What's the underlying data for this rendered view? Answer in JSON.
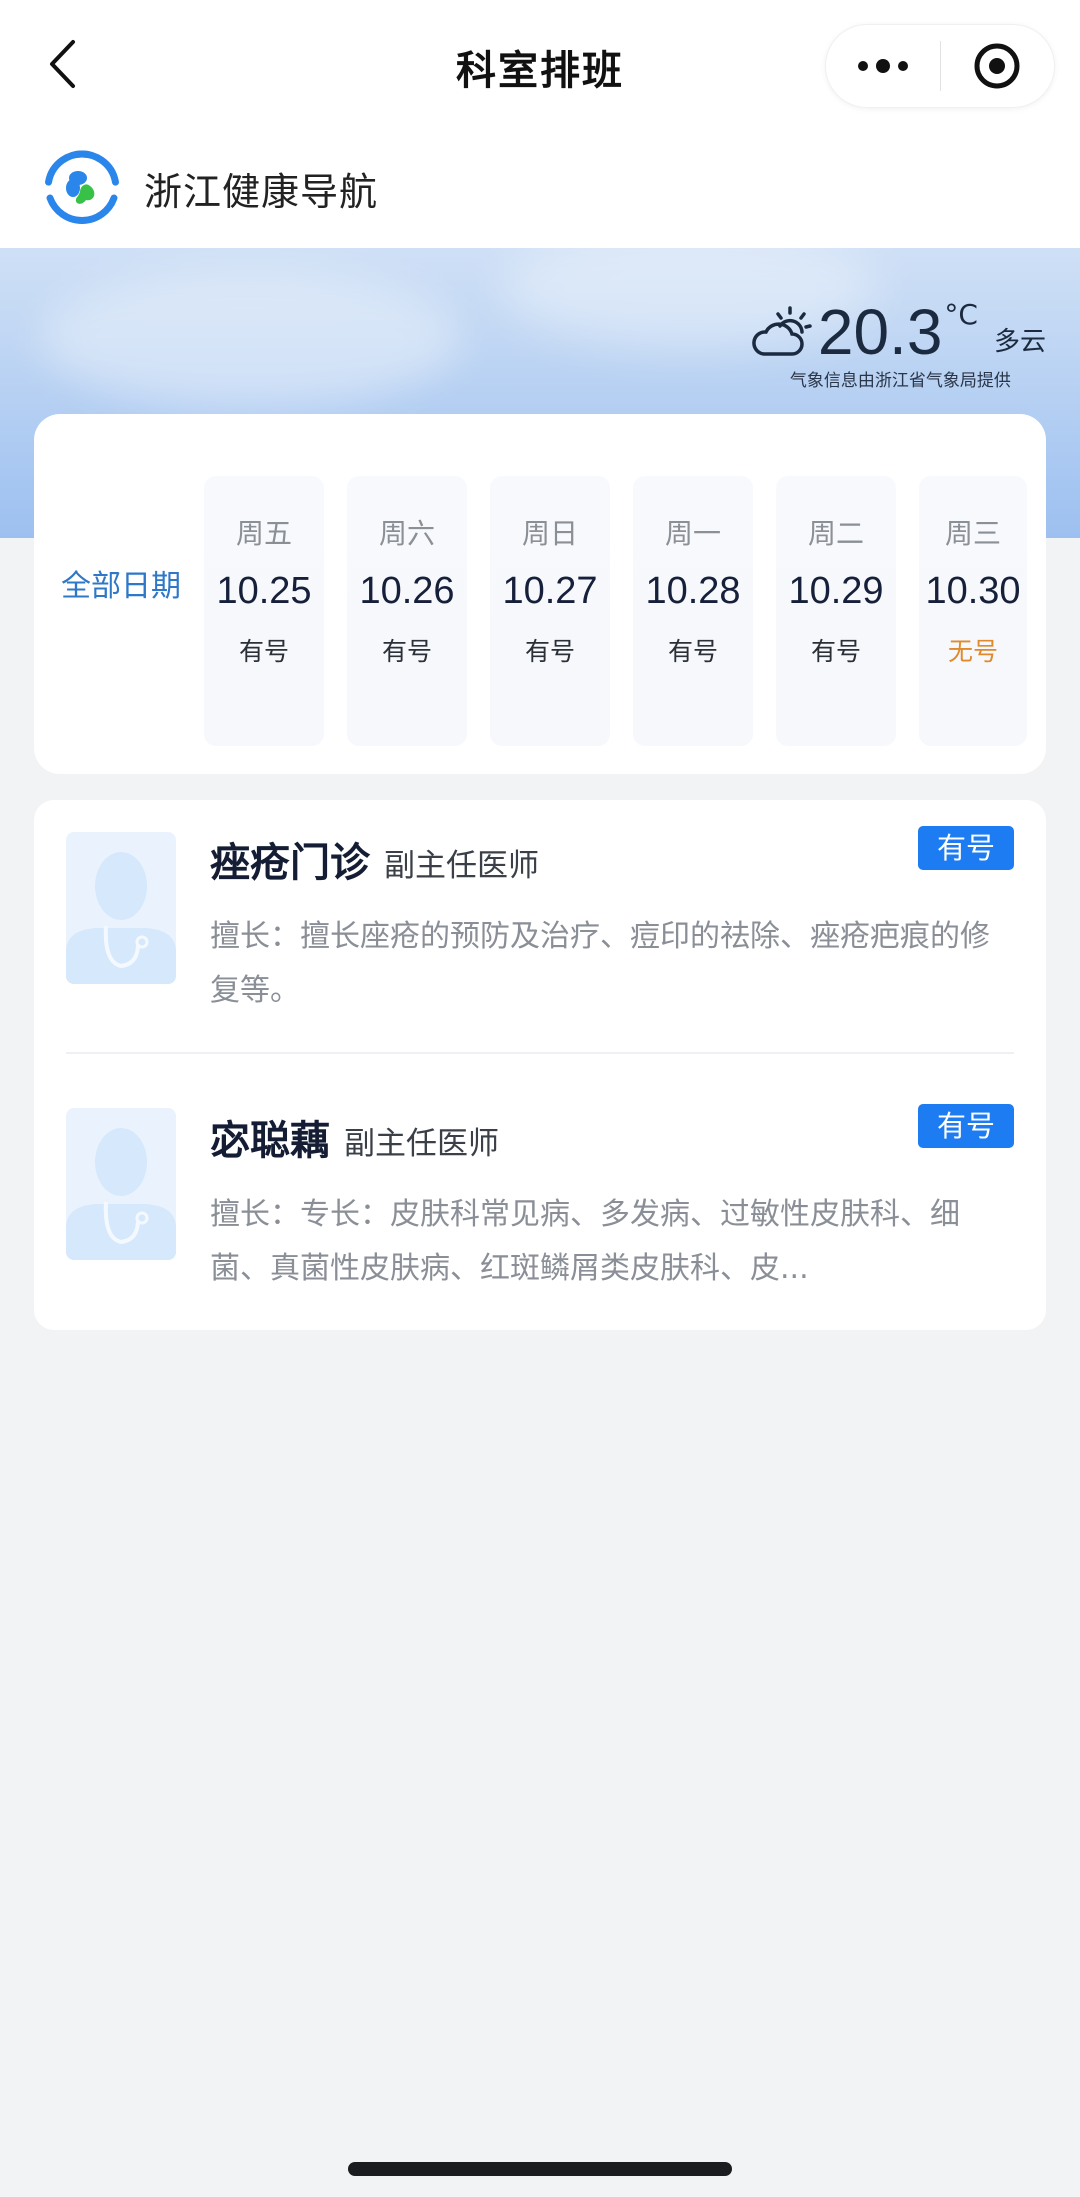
{
  "navbar": {
    "title": "科室排班",
    "back_icon": "chevron-left-icon",
    "more_icon": "more-dots-icon",
    "close_icon": "target-close-icon"
  },
  "brand": {
    "name": "浙江健康导航",
    "logo_icon": "health-cross-logo-icon"
  },
  "weather": {
    "icon": "partly-cloudy-icon",
    "temperature": "20.3",
    "unit": "°C",
    "condition": "多云",
    "source": "气象信息由浙江省气象局提供"
  },
  "dates": {
    "all_label": "全部日期",
    "days": [
      {
        "weekday": "周五",
        "date": "10.25",
        "status": "有号",
        "available": true
      },
      {
        "weekday": "周六",
        "date": "10.26",
        "status": "有号",
        "available": true
      },
      {
        "weekday": "周日",
        "date": "10.27",
        "status": "有号",
        "available": true
      },
      {
        "weekday": "周一",
        "date": "10.28",
        "status": "有号",
        "available": true
      },
      {
        "weekday": "周二",
        "date": "10.29",
        "status": "有号",
        "available": true
      },
      {
        "weekday": "周三",
        "date": "10.30",
        "status": "无号",
        "available": false
      }
    ]
  },
  "doctors": [
    {
      "name": "痤疮门诊",
      "title": "副主任医师",
      "badge": "有号",
      "description": "擅长：擅长座疮的预防及治疗、痘印的祛除、痤疮疤痕的修复等。"
    },
    {
      "name": "宓聪藕",
      "title": "副主任医师",
      "badge": "有号",
      "description": "擅长：专长：皮肤科常见病、多发病、过敏性皮肤科、细菌、真菌性皮肤病、红斑鳞屑类皮肤科、皮..."
    }
  ],
  "colors": {
    "accent": "#1d7cf2",
    "link_blue": "#2f78c8",
    "unavailable": "#e08a2c",
    "background": "#f2f3f5"
  }
}
